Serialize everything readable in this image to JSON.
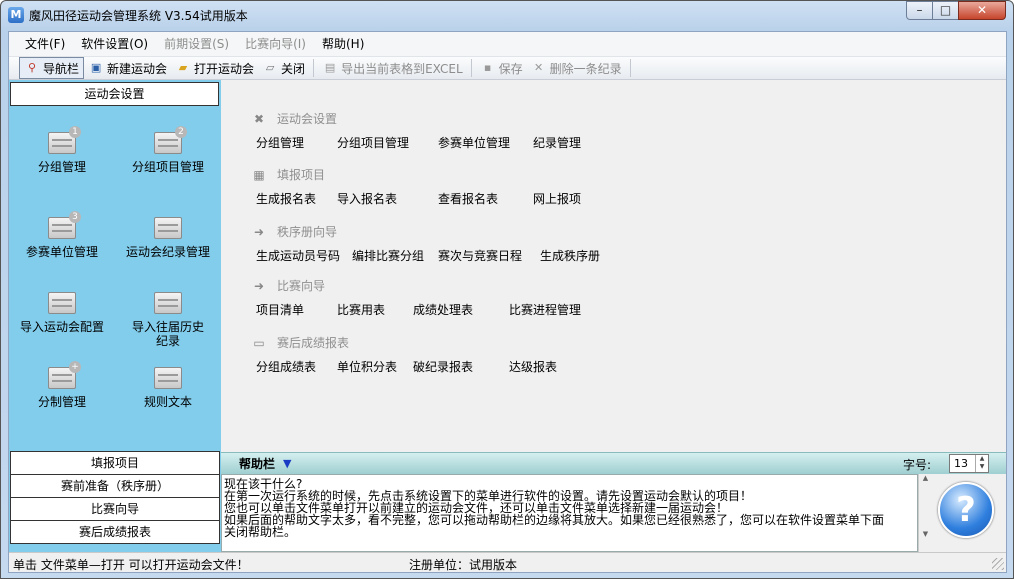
{
  "window": {
    "title": "魔风田径运动会管理系统 V3.54试用版本",
    "icon_letter": "M"
  },
  "menu": [
    {
      "label": "文件(F)",
      "enabled": true
    },
    {
      "label": "软件设置(O)",
      "enabled": true
    },
    {
      "label": "前期设置(S)",
      "enabled": false
    },
    {
      "label": "比赛向导(I)",
      "enabled": false
    },
    {
      "label": "帮助(H)",
      "enabled": true
    }
  ],
  "toolbar": {
    "nav": "导航栏",
    "new_meet": "新建运动会",
    "open_meet": "打开运动会",
    "close": "关闭",
    "export_excel": "导出当前表格到EXCEL",
    "save": "保存",
    "delete_record": "删除一条纪录"
  },
  "left_panel": {
    "header": "运动会设置",
    "items": [
      {
        "label": "分组管理",
        "badge": "1"
      },
      {
        "label": "分组项目管理",
        "badge": "2"
      },
      {
        "label": "参赛单位管理",
        "badge": "3"
      },
      {
        "label": "运动会纪录管理",
        "badge": ""
      },
      {
        "label": "导入运动会配置",
        "badge": ""
      },
      {
        "label": "导入往届历史纪录",
        "badge": ""
      },
      {
        "label": "分制管理",
        "badge": "+"
      },
      {
        "label": "规则文本",
        "badge": ""
      }
    ],
    "tabs": [
      "填报项目",
      "赛前准备（秩序册）",
      "比赛向导",
      "赛后成绩报表"
    ]
  },
  "main": {
    "sections": [
      {
        "title": "运动会设置",
        "icon": "tools-icon",
        "links": [
          "分组管理",
          "分组项目管理",
          "参赛单位管理",
          "纪录管理"
        ]
      },
      {
        "title": "填报项目",
        "icon": "table-icon",
        "links": [
          "生成报名表",
          "导入报名表",
          "查看报名表",
          "网上报项"
        ]
      },
      {
        "title": "秩序册向导",
        "icon": "arrow-circle-icon",
        "links": [
          "生成运动员号码",
          "编排比赛分组",
          "赛次与竞赛日程",
          "生成秩序册"
        ]
      },
      {
        "title": "比赛向导",
        "icon": "arrow-circle-icon",
        "links": [
          "项目清单",
          "比赛用表",
          "成绩处理表",
          "比赛进程管理"
        ]
      },
      {
        "title": "赛后成绩报表",
        "icon": "report-icon",
        "links": [
          "分组成绩表",
          "单位积分表",
          "破纪录报表",
          "达级报表"
        ]
      }
    ]
  },
  "help": {
    "title": "帮助栏",
    "font_label": "字号:",
    "font_size": "13",
    "lines": [
      "现在该干什么?",
      "      在第一次运行系统的时候，先点击系统设置下的菜单进行软件的设置。请先设置运动会默认的项目！",
      "      您也可以单击文件菜单打开以前建立的运动会文件，还可以单击文件菜单选择新建一届运动会！",
      "      如果后面的帮助文字太多，看不完整，您可以拖动帮助栏的边缘将其放大。如果您已经很熟悉了，您可以在软件设置菜单下面",
      "关闭帮助栏。"
    ]
  },
  "status": {
    "left": "单击 文件菜单—打开 可以打开运动会文件！",
    "right": "注册单位：试用版本"
  }
}
